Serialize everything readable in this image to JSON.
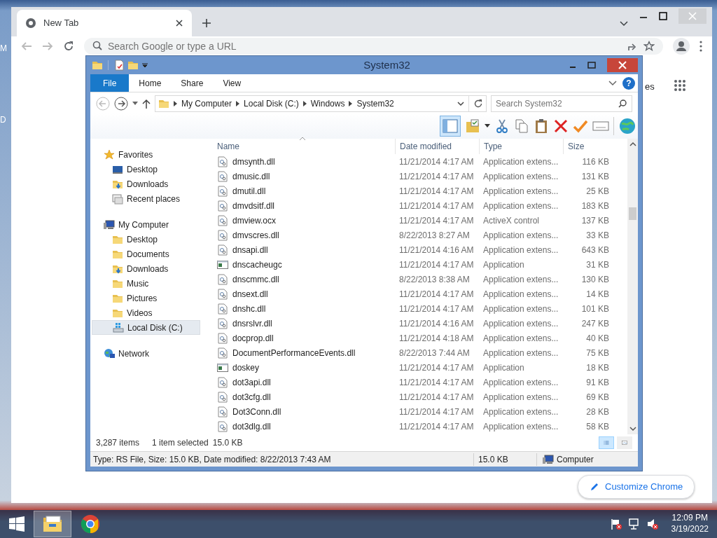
{
  "desktop": {
    "icon_labels": [
      "M",
      "D"
    ]
  },
  "browser": {
    "tab_title": "New Tab",
    "omnibox": {
      "placeholder": "Search Google or type a URL"
    },
    "partial_link": "es",
    "customize_button": "Customize Chrome"
  },
  "explorer": {
    "title": "System32",
    "ribbon_tabs": [
      {
        "label": "File",
        "kind": "file"
      },
      {
        "label": "Home",
        "kind": "tab"
      },
      {
        "label": "Share",
        "kind": "tab"
      },
      {
        "label": "View",
        "kind": "tab"
      }
    ],
    "help_button": "?",
    "breadcrumb": [
      "My Computer",
      "Local Disk (C:)",
      "Windows",
      "System32"
    ],
    "search": {
      "placeholder": "Search System32"
    },
    "nav_groups": [
      {
        "label": "Favorites",
        "kind": "star",
        "children": [
          {
            "label": "Desktop",
            "kind": "desktop",
            "selected": false
          },
          {
            "label": "Downloads",
            "kind": "downloads",
            "selected": false
          },
          {
            "label": "Recent places",
            "kind": "recent",
            "selected": false
          }
        ]
      },
      {
        "label": "My Computer",
        "kind": "computer",
        "children": [
          {
            "label": "Desktop",
            "kind": "folder",
            "selected": false
          },
          {
            "label": "Documents",
            "kind": "folder",
            "selected": false
          },
          {
            "label": "Downloads",
            "kind": "downloads",
            "selected": false
          },
          {
            "label": "Music",
            "kind": "folder",
            "selected": false
          },
          {
            "label": "Pictures",
            "kind": "folder",
            "selected": false
          },
          {
            "label": "Videos",
            "kind": "folder",
            "selected": false
          },
          {
            "label": "Local Disk (C:)",
            "kind": "drive",
            "selected": true
          }
        ]
      },
      {
        "label": "Network",
        "kind": "network"
      }
    ],
    "columns": [
      "Name",
      "Date modified",
      "Type",
      "Size"
    ],
    "rows": [
      {
        "name": "dmsynth.dll",
        "kind": "dll",
        "date": "11/21/2014 4:17 AM",
        "type": "Application extens...",
        "size": "116 KB"
      },
      {
        "name": "dmusic.dll",
        "kind": "dll",
        "date": "11/21/2014 4:17 AM",
        "type": "Application extens...",
        "size": "131 KB"
      },
      {
        "name": "dmutil.dll",
        "kind": "dll",
        "date": "11/21/2014 4:17 AM",
        "type": "Application extens...",
        "size": "25 KB"
      },
      {
        "name": "dmvdsitf.dll",
        "kind": "dll",
        "date": "11/21/2014 4:17 AM",
        "type": "Application extens...",
        "size": "183 KB"
      },
      {
        "name": "dmview.ocx",
        "kind": "dll",
        "date": "11/21/2014 4:17 AM",
        "type": "ActiveX control",
        "size": "137 KB"
      },
      {
        "name": "dmvscres.dll",
        "kind": "dll",
        "date": "8/22/2013 8:27 AM",
        "type": "Application extens...",
        "size": "33 KB"
      },
      {
        "name": "dnsapi.dll",
        "kind": "dll",
        "date": "11/21/2014 4:16 AM",
        "type": "Application extens...",
        "size": "643 KB"
      },
      {
        "name": "dnscacheugc",
        "kind": "app",
        "date": "11/21/2014 4:17 AM",
        "type": "Application",
        "size": "31 KB"
      },
      {
        "name": "dnscmmc.dll",
        "kind": "dll",
        "date": "8/22/2013 8:38 AM",
        "type": "Application extens...",
        "size": "130 KB"
      },
      {
        "name": "dnsext.dll",
        "kind": "dll",
        "date": "11/21/2014 4:17 AM",
        "type": "Application extens...",
        "size": "14 KB"
      },
      {
        "name": "dnshc.dll",
        "kind": "dll",
        "date": "11/21/2014 4:17 AM",
        "type": "Application extens...",
        "size": "101 KB"
      },
      {
        "name": "dnsrslvr.dll",
        "kind": "dll",
        "date": "11/21/2014 4:16 AM",
        "type": "Application extens...",
        "size": "247 KB"
      },
      {
        "name": "docprop.dll",
        "kind": "dll",
        "date": "11/21/2014 4:18 AM",
        "type": "Application extens...",
        "size": "40 KB"
      },
      {
        "name": "DocumentPerformanceEvents.dll",
        "kind": "dll",
        "date": "8/22/2013 7:44 AM",
        "type": "Application extens...",
        "size": "75 KB"
      },
      {
        "name": "doskey",
        "kind": "app",
        "date": "11/21/2014 4:17 AM",
        "type": "Application",
        "size": "18 KB"
      },
      {
        "name": "dot3api.dll",
        "kind": "dll",
        "date": "11/21/2014 4:17 AM",
        "type": "Application extens...",
        "size": "91 KB"
      },
      {
        "name": "dot3cfg.dll",
        "kind": "dll",
        "date": "11/21/2014 4:17 AM",
        "type": "Application extens...",
        "size": "69 KB"
      },
      {
        "name": "Dot3Conn.dll",
        "kind": "dll",
        "date": "11/21/2014 4:17 AM",
        "type": "Application extens...",
        "size": "28 KB"
      },
      {
        "name": "dot3dlg.dll",
        "kind": "dll",
        "date": "11/21/2014 4:17 AM",
        "type": "Application extens...",
        "size": "58 KB"
      }
    ],
    "status": {
      "count": "3,287 items",
      "selection": "1 item selected",
      "selection_size": "15.0 KB"
    },
    "view_modes": [
      {
        "kind": "details",
        "selected": true
      },
      {
        "kind": "large-icons",
        "selected": false
      }
    ],
    "details_bar": {
      "info": "Type: RS File, Size: 15.0 KB, Date modified: 8/22/2013 7:43 AM",
      "size": "15.0 KB",
      "zone": "Computer"
    }
  },
  "taskbar": {
    "apps": [
      {
        "kind": "explorer",
        "selected": true
      },
      {
        "kind": "chrome",
        "selected": false
      }
    ],
    "clock": {
      "time": "12:09 PM",
      "date": "3/19/2022"
    }
  }
}
